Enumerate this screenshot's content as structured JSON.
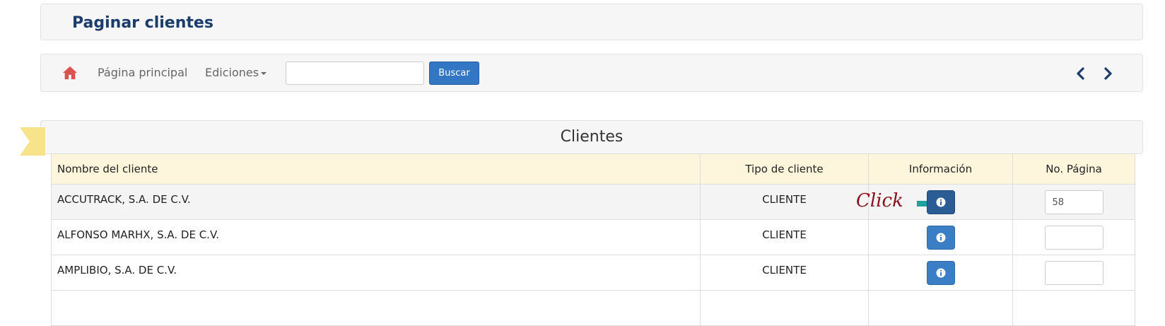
{
  "header": {
    "title": "Paginar clientes"
  },
  "nav": {
    "home_label": "Página principal",
    "editions_label": "Ediciones",
    "search": {
      "value": "",
      "placeholder": ""
    },
    "search_button": "Buscar",
    "icons": [
      "home-icon",
      "chevron-left-icon",
      "chevron-right-icon"
    ],
    "home_icon_color": "#d9534f",
    "arrow_color": "#1a3d6b"
  },
  "table": {
    "heading": "Clientes",
    "columns": [
      "Nombre del cliente",
      "Tipo de cliente",
      "Información",
      "No. Página"
    ],
    "rows": [
      {
        "name": "ACCUTRACK, S.A. DE C.V.",
        "type": "CLIENTE",
        "page": "58"
      },
      {
        "name": "ALFONSO MARHX, S.A. DE C.V.",
        "type": "CLIENTE",
        "page": ""
      },
      {
        "name": "AMPLIBIO, S.A. DE C.V.",
        "type": "CLIENTE",
        "page": ""
      }
    ]
  },
  "annotation": {
    "text": "Click",
    "text_color": "#8b0f1a",
    "arrow_color": "#1aa39b"
  },
  "colors": {
    "header_bg": "#fdf6dc",
    "button_primary": "#3276c4",
    "info_button": "#3a7fc6",
    "ribbon": "#f7e38a"
  }
}
